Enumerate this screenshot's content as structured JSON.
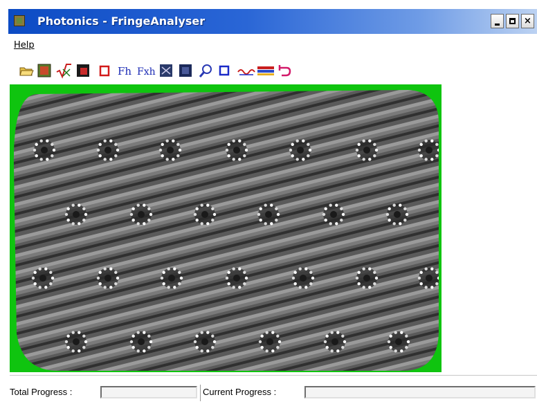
{
  "window": {
    "title": "Photonics - FringeAnalyser",
    "minimize_glyph": "",
    "maximize_glyph": "",
    "close_glyph": "×"
  },
  "menu": {
    "items": [
      {
        "label": "Help"
      }
    ]
  },
  "toolbar": {
    "tools": [
      {
        "icon": "open-folder-icon"
      },
      {
        "icon": "image-icon"
      },
      {
        "icon": "square-root-icon"
      },
      {
        "icon": "dark-image-icon"
      },
      {
        "icon": "red-square-icon"
      },
      {
        "icon": "fh-icon",
        "text": "Fh"
      },
      {
        "icon": "fxh-icon",
        "text": "Fxh"
      },
      {
        "icon": "grid-image-icon"
      },
      {
        "icon": "dark-grid-icon"
      },
      {
        "icon": "zoom-icon"
      },
      {
        "icon": "blue-square-icon"
      },
      {
        "icon": "wave-icon"
      },
      {
        "icon": "palette-icon"
      },
      {
        "icon": "undo-icon"
      }
    ]
  },
  "image": {
    "background_color": "#0fc40f",
    "description_icon": "fringe-pattern-icon"
  },
  "status": {
    "total_label": "Total Progress :",
    "current_label": "Current Progress :",
    "total_progress": 0,
    "current_progress": 0
  },
  "colors": {
    "titlebar_start": "#0c4bc4",
    "titlebar_end": "#bcd2f2",
    "green_background": "#0fc40f"
  }
}
